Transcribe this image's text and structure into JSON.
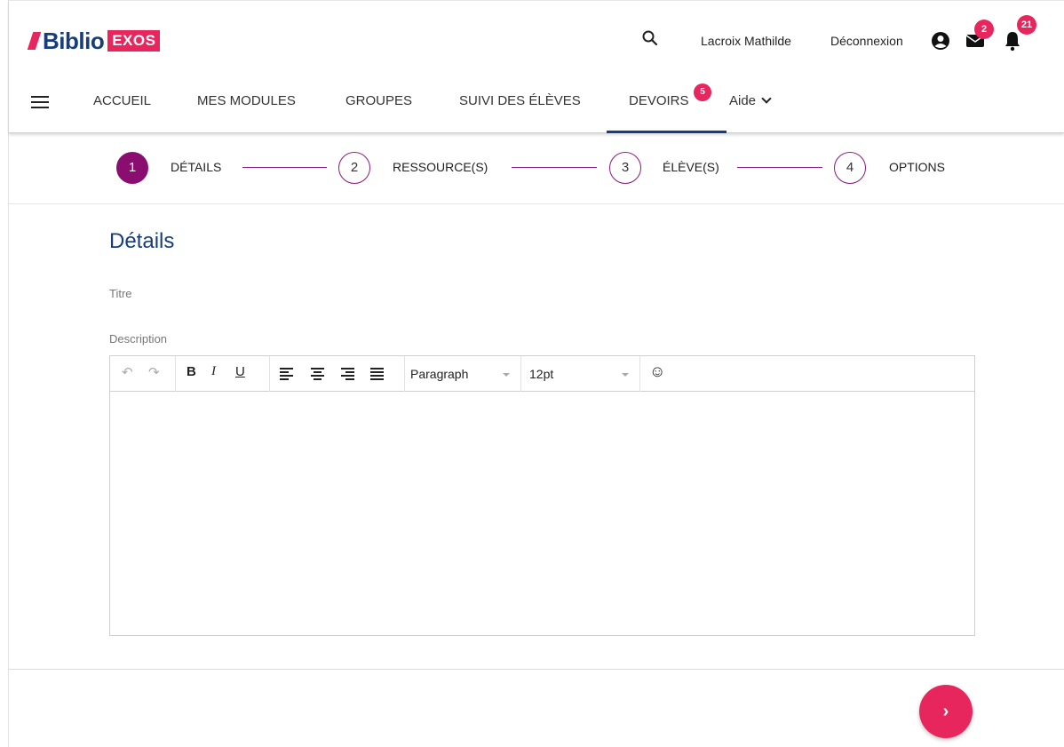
{
  "brand": {
    "name": "Biblio",
    "suffix": "EXOS",
    "accent": "#e8265e",
    "primary": "#173e7a"
  },
  "header": {
    "user_name": "Lacroix Mathilde",
    "logout_label": "Déconnexion",
    "mail_count": "2",
    "notification_count": "21",
    "icons": [
      "search-icon",
      "account-icon",
      "mail-icon",
      "bell-icon"
    ]
  },
  "nav": {
    "items": [
      {
        "label": "ACCUEIL"
      },
      {
        "label": "MES MODULES"
      },
      {
        "label": "GROUPES"
      },
      {
        "label": "SUIVI DES ÉLÈVES"
      },
      {
        "label": "DEVOIRS",
        "badge": "5",
        "active": true
      },
      {
        "label": "Aide"
      }
    ]
  },
  "stepper": {
    "accent": "#8a0e70",
    "steps": [
      {
        "number": "1",
        "label": "DÉTAILS",
        "active": true
      },
      {
        "number": "2",
        "label": "RESSOURCE(S)"
      },
      {
        "number": "3",
        "label": "ÉLÈVE(S)"
      },
      {
        "number": "4",
        "label": "OPTIONS"
      }
    ]
  },
  "main": {
    "title": "Détails",
    "title_label": "Titre",
    "description_label": "Description"
  },
  "editor": {
    "toolbar": {
      "undo": "↶",
      "redo": "↷",
      "bold": "B",
      "italic": "I",
      "underline": "U",
      "format_value": "Paragraph",
      "size_value": "12pt",
      "emoji": "☺"
    },
    "content": ""
  },
  "footer": {
    "next_symbol": "›"
  }
}
